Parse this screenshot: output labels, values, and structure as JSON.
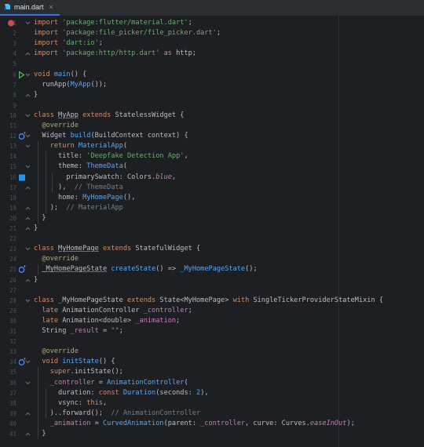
{
  "tab": {
    "filename": "main.dart",
    "close": "×"
  },
  "icons": {
    "tab_icon": "dart-file-icon",
    "breakpoint": "breakpoint-icon",
    "run": "run-icon",
    "override": "override-icon",
    "color_swatch": "color-swatch-icon"
  },
  "colors": {
    "accent": "#3574f0",
    "breakpoint": "#c94f4f",
    "run": "#5fb865",
    "swatch": "#2196f3",
    "override": "#548af7"
  },
  "lines": [
    {
      "n": "1",
      "gutter": "breakpoint",
      "fold": "open",
      "segs": [
        [
          "kw",
          "import "
        ],
        [
          "str",
          "'package:flutter/material.dart'"
        ],
        [
          "",
          ";"
        ]
      ]
    },
    {
      "n": "2",
      "segs": [
        [
          "kw",
          "import "
        ],
        [
          "str",
          "'package:file_picker/file_picker.dart'"
        ],
        [
          "",
          ";"
        ]
      ]
    },
    {
      "n": "3",
      "segs": [
        [
          "kw",
          "import "
        ],
        [
          "str",
          "'dart:io'"
        ],
        [
          "",
          ";"
        ]
      ]
    },
    {
      "n": "4",
      "fold": "close",
      "segs": [
        [
          "kw",
          "import "
        ],
        [
          "str",
          "'package:http/http.dart' "
        ],
        [
          "kw",
          "as "
        ],
        [
          "",
          "http;"
        ]
      ]
    },
    {
      "n": "5",
      "segs": []
    },
    {
      "n": "6",
      "gutter": "run",
      "fold": "open",
      "segs": [
        [
          "kw",
          "void "
        ],
        [
          "fn",
          "main"
        ],
        [
          "",
          "() {"
        ]
      ]
    },
    {
      "n": "7",
      "segs": [
        [
          "",
          "  runApp("
        ],
        [
          "cls",
          "MyApp"
        ],
        [
          "",
          "());"
        ]
      ]
    },
    {
      "n": "8",
      "fold": "close",
      "segs": [
        [
          "",
          "}"
        ]
      ]
    },
    {
      "n": "9",
      "segs": []
    },
    {
      "n": "10",
      "fold": "open",
      "segs": [
        [
          "kw",
          "class "
        ],
        [
          "ul",
          "MyApp"
        ],
        [
          "kw",
          " extends "
        ],
        [
          "",
          "StatelessWidget {"
        ]
      ]
    },
    {
      "n": "11",
      "segs": [
        [
          "ann",
          "  @override"
        ]
      ]
    },
    {
      "n": "12",
      "gutter": "override",
      "fold": "open",
      "segs": [
        [
          "",
          "  Widget "
        ],
        [
          "fn",
          "build"
        ],
        [
          "",
          "(BuildContext context) {"
        ]
      ]
    },
    {
      "n": "13",
      "fold": "open",
      "segs": [
        [
          "kw",
          "    return "
        ],
        [
          "cls",
          "MaterialApp"
        ],
        [
          "",
          "("
        ]
      ]
    },
    {
      "n": "14",
      "segs": [
        [
          "",
          "      title: "
        ],
        [
          "str",
          "'Deepfake Detection App'"
        ],
        [
          "",
          ","
        ]
      ]
    },
    {
      "n": "15",
      "fold": "open",
      "segs": [
        [
          "",
          "      theme: "
        ],
        [
          "cls",
          "ThemeData"
        ],
        [
          "",
          "("
        ]
      ]
    },
    {
      "n": "16",
      "gutter": "swatch",
      "segs": [
        [
          "",
          "        primarySwatch: Colors."
        ],
        [
          "itl",
          "blue"
        ],
        [
          "",
          ","
        ]
      ]
    },
    {
      "n": "17",
      "fold": "close",
      "segs": [
        [
          "",
          "      ),  "
        ],
        [
          "cm",
          "// ThemeData"
        ]
      ]
    },
    {
      "n": "18",
      "segs": [
        [
          "",
          "      home: "
        ],
        [
          "cls",
          "MyHomePage"
        ],
        [
          "",
          "(),"
        ]
      ]
    },
    {
      "n": "19",
      "fold": "close",
      "segs": [
        [
          "",
          "    );  "
        ],
        [
          "cm",
          "// MaterialApp"
        ]
      ]
    },
    {
      "n": "20",
      "fold": "close",
      "segs": [
        [
          "",
          "  }"
        ]
      ]
    },
    {
      "n": "21",
      "fold": "close",
      "segs": [
        [
          "",
          "}"
        ]
      ]
    },
    {
      "n": "22",
      "segs": []
    },
    {
      "n": "23",
      "fold": "open",
      "segs": [
        [
          "kw",
          "class "
        ],
        [
          "ul",
          "MyHomePage"
        ],
        [
          "kw",
          " extends "
        ],
        [
          "",
          "StatefulWidget {"
        ]
      ]
    },
    {
      "n": "24",
      "segs": [
        [
          "ann",
          "  @override"
        ]
      ]
    },
    {
      "n": "25",
      "gutter": "override",
      "segs": [
        [
          "",
          "  "
        ],
        [
          "ul",
          "_MyHomePageState"
        ],
        [
          "",
          ""
        ],
        [
          "fn",
          " createState"
        ],
        [
          "",
          "() => "
        ],
        [
          "cls",
          "_MyHomePageState"
        ],
        [
          "",
          "();"
        ]
      ]
    },
    {
      "n": "26",
      "fold": "close",
      "segs": [
        [
          "",
          "}"
        ]
      ]
    },
    {
      "n": "27",
      "segs": []
    },
    {
      "n": "28",
      "fold": "open",
      "segs": [
        [
          "kw",
          "class "
        ],
        [
          "",
          "_MyHomePageState "
        ],
        [
          "kw",
          "extends "
        ],
        [
          "",
          "State<MyHomePage> "
        ],
        [
          "kw",
          "with "
        ],
        [
          "",
          "SingleTickerProviderStateMixin {"
        ]
      ]
    },
    {
      "n": "29",
      "segs": [
        [
          "kw",
          "  late "
        ],
        [
          "",
          "AnimationController "
        ],
        [
          "fld",
          "_controller"
        ],
        [
          "",
          ";"
        ]
      ]
    },
    {
      "n": "30",
      "segs": [
        [
          "kw",
          "  late "
        ],
        [
          "",
          "Animation<double> "
        ],
        [
          "fld",
          "_animation"
        ],
        [
          "",
          ";"
        ]
      ]
    },
    {
      "n": "31",
      "segs": [
        [
          "",
          "  String "
        ],
        [
          "fld",
          "_result"
        ],
        [
          "",
          " = "
        ],
        [
          "str",
          "\"\""
        ],
        [
          "",
          ";"
        ]
      ]
    },
    {
      "n": "32",
      "segs": []
    },
    {
      "n": "33",
      "segs": [
        [
          "ann",
          "  @override"
        ]
      ]
    },
    {
      "n": "34",
      "gutter": "override",
      "fold": "open",
      "segs": [
        [
          "kw",
          "  void "
        ],
        [
          "fn",
          "initState"
        ],
        [
          "",
          "() {"
        ]
      ]
    },
    {
      "n": "35",
      "segs": [
        [
          "kw",
          "    super"
        ],
        [
          "",
          ".initState();"
        ]
      ]
    },
    {
      "n": "36",
      "fold": "open",
      "segs": [
        [
          "fld",
          "    _controller"
        ],
        [
          "",
          " = "
        ],
        [
          "cls",
          "AnimationController"
        ],
        [
          "",
          "("
        ]
      ]
    },
    {
      "n": "37",
      "segs": [
        [
          "",
          "      duration: "
        ],
        [
          "kw",
          "const "
        ],
        [
          "cls",
          "Duration"
        ],
        [
          "",
          "(seconds: "
        ],
        [
          "fn",
          "2"
        ],
        [
          "",
          "),"
        ]
      ]
    },
    {
      "n": "38",
      "segs": [
        [
          "",
          "      vsync: "
        ],
        [
          "kw",
          "this"
        ],
        [
          "",
          ","
        ]
      ]
    },
    {
      "n": "39",
      "fold": "close",
      "segs": [
        [
          "",
          "    )..forward();  "
        ],
        [
          "cm",
          "// AnimationController"
        ]
      ]
    },
    {
      "n": "40",
      "segs": [
        [
          "fld",
          "    _animation"
        ],
        [
          "",
          " = "
        ],
        [
          "cls",
          "CurvedAnimation"
        ],
        [
          "",
          "(parent: "
        ],
        [
          "fld",
          "_controller"
        ],
        [
          "",
          ", curve: Curves."
        ],
        [
          "itl",
          "easeInOut"
        ],
        [
          "",
          ");"
        ]
      ]
    },
    {
      "n": "41",
      "fold": "close",
      "segs": [
        [
          "",
          "  }"
        ]
      ]
    }
  ]
}
